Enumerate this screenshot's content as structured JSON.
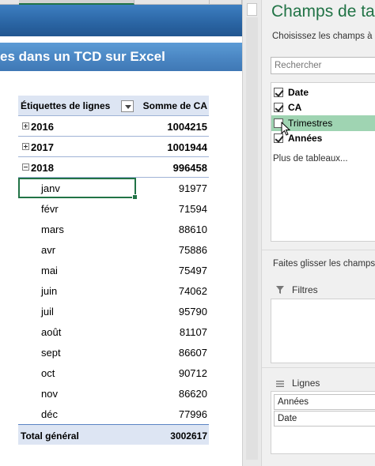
{
  "sheet": {
    "title": "es dans un TCD sur Excel"
  },
  "pivot": {
    "header_label": "Étiquettes de lignes",
    "header_value": "Somme de CA",
    "years": [
      {
        "label": "2016",
        "value": "1004215",
        "expanded": false
      },
      {
        "label": "2017",
        "value": "1001944",
        "expanded": false
      },
      {
        "label": "2018",
        "value": "996458",
        "expanded": true
      }
    ],
    "months": [
      {
        "label": "janv",
        "value": "91977"
      },
      {
        "label": "févr",
        "value": "71594"
      },
      {
        "label": "mars",
        "value": "88610"
      },
      {
        "label": "avr",
        "value": "75886"
      },
      {
        "label": "mai",
        "value": "75497"
      },
      {
        "label": "juin",
        "value": "74062"
      },
      {
        "label": "juil",
        "value": "95790"
      },
      {
        "label": "août",
        "value": "81107"
      },
      {
        "label": "sept",
        "value": "86607"
      },
      {
        "label": "oct",
        "value": "90712"
      },
      {
        "label": "nov",
        "value": "86620"
      },
      {
        "label": "déc",
        "value": "77996"
      }
    ],
    "total_label": "Total général",
    "total_value": "3002617"
  },
  "pane": {
    "title": "Champs de tabl",
    "subtitle": "Choisissez les champs à i",
    "search_placeholder": "Rechercher",
    "fields": [
      {
        "name": "Date",
        "checked": true
      },
      {
        "name": "CA",
        "checked": true
      },
      {
        "name": "Trimestres",
        "checked": false
      },
      {
        "name": "Années",
        "checked": true
      }
    ],
    "more_tables": "Plus de tableaux...",
    "drag_hint": "Faites glisser les champs",
    "filters_label": "Filtres",
    "rows_label": "Lignes",
    "row_fields": [
      "Années",
      "Date"
    ]
  },
  "colors": {
    "excel_green": "#217346",
    "pivot_header": "#dde5f3",
    "title_band": "#4a86c3",
    "hover_field": "#9fd4b2"
  }
}
